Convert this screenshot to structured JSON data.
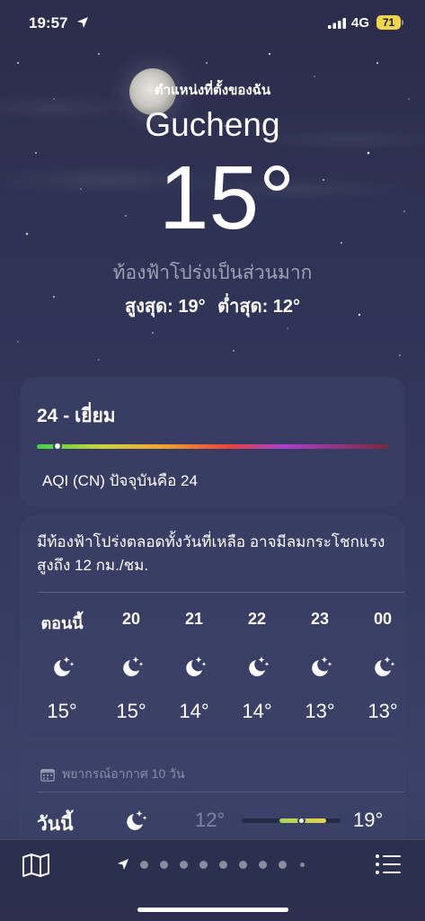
{
  "status_bar": {
    "time": "19:57",
    "network": "4G",
    "battery": "71"
  },
  "header": {
    "location_label": "ตำแหน่งที่ตั้งของฉัน",
    "city": "Gucheng",
    "temperature": "15°",
    "condition": "ท้องฟ้าโปร่งเป็นส่วนมาก",
    "high": "สูงสุด: 19°",
    "low": "ต่ำสุด: 12°"
  },
  "aqi": {
    "title": "24 - เยี่ยม",
    "level_fraction": 0.06,
    "description": "AQI (CN) ปัจจุบันคือ 24"
  },
  "hourly": {
    "summary": "มีท้องฟ้าโปร่งตลอดทั้งวันที่เหลือ อาจมีลมกระโชกแรงสูงถึง 12 กม./ชม.",
    "hours": [
      {
        "label": "ตอนนี้",
        "icon": "moon-stars-icon",
        "temp": "15°"
      },
      {
        "label": "20",
        "icon": "moon-stars-icon",
        "temp": "15°"
      },
      {
        "label": "21",
        "icon": "moon-stars-icon",
        "temp": "14°"
      },
      {
        "label": "22",
        "icon": "moon-stars-icon",
        "temp": "14°"
      },
      {
        "label": "23",
        "icon": "moon-stars-icon",
        "temp": "13°"
      },
      {
        "label": "00",
        "icon": "moon-stars-icon",
        "temp": "13°"
      }
    ]
  },
  "daily": {
    "header": "พยากรณ์อากาศ 10 วัน",
    "days": [
      {
        "label": "วันนี้",
        "icon": "moon-stars-icon",
        "low": "12°",
        "high": "19°"
      }
    ]
  },
  "bottom_bar": {
    "page_count": 9,
    "current_page": 0
  },
  "colors": {
    "background": "#2f3356",
    "battery": "#f1d54a",
    "aqi_good": "#3fd34a"
  }
}
